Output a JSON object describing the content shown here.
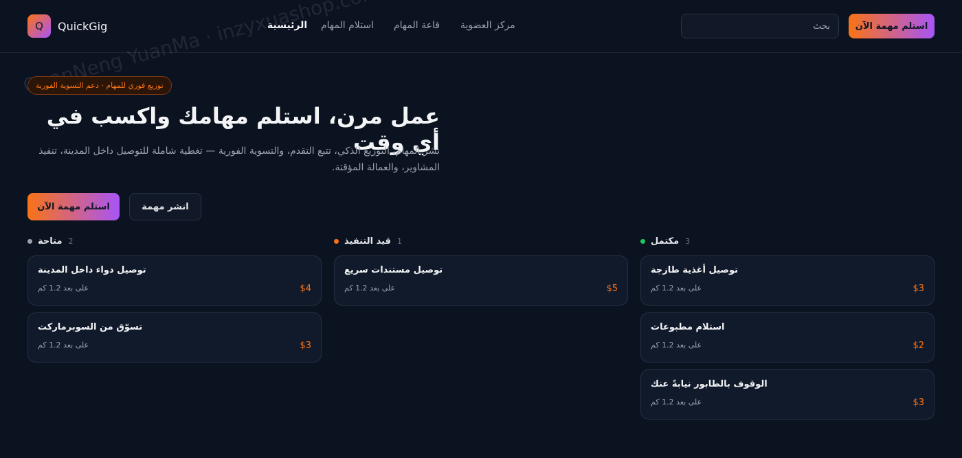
{
  "header": {
    "logo_letter": "Q",
    "brand": "QuickGig",
    "nav": [
      {
        "label": "الرئيسية",
        "active": true
      },
      {
        "label": "استلام المهام",
        "active": false
      },
      {
        "label": "قاعة المهام",
        "active": false
      },
      {
        "label": "مركز العضوية",
        "active": false
      }
    ],
    "search_placeholder": "بحث",
    "cta": "استلم مهمة الآن"
  },
  "hero": {
    "badge": "توزيع فوري للمهام · دعم التسوية الفورية",
    "title": "عمل مرن، استلم مهامك واكسب في أي وقت",
    "description": "نشر المهام، التوزيع الذكي، تتبع التقدم، والتسوية الفورية — تغطية شاملة للتوصيل داخل المدينة، تنفيذ المشاوير، والعمالة المؤقتة.",
    "primary_button": "استلم مهمة الآن",
    "secondary_button": "انشر مهمة"
  },
  "columns": [
    {
      "name": "متاحة",
      "count": "2",
      "dot_color": "#9ca3af",
      "cards": [
        {
          "title": "توصيل دواء داخل المدينة",
          "distance": "على بعد 1.2 كم",
          "price": "$4"
        },
        {
          "title": "تسوّق من السوبرماركت",
          "distance": "على بعد 1.2 كم",
          "price": "$3"
        }
      ]
    },
    {
      "name": "قيد التنفيذ",
      "count": "1",
      "dot_color": "#f97316",
      "cards": [
        {
          "title": "توصيل مستندات سريع",
          "distance": "على بعد 1.2 كم",
          "price": "$5"
        }
      ]
    },
    {
      "name": "مكتمل",
      "count": "3",
      "dot_color": "#22c55e",
      "cards": [
        {
          "title": "توصيل أغذية طازجة",
          "distance": "على بعد 1.2 كم",
          "price": "$3"
        },
        {
          "title": "استلام مطبوعات",
          "distance": "على بعد 1.2 كم",
          "price": "$2"
        },
        {
          "title": "الوقوف بالطابور نيابةً عنك",
          "distance": "على بعد 1.2 كم",
          "price": "$3"
        }
      ]
    }
  ],
  "watermark": "QuanNeng YuanMa · inzyxuashop.com"
}
